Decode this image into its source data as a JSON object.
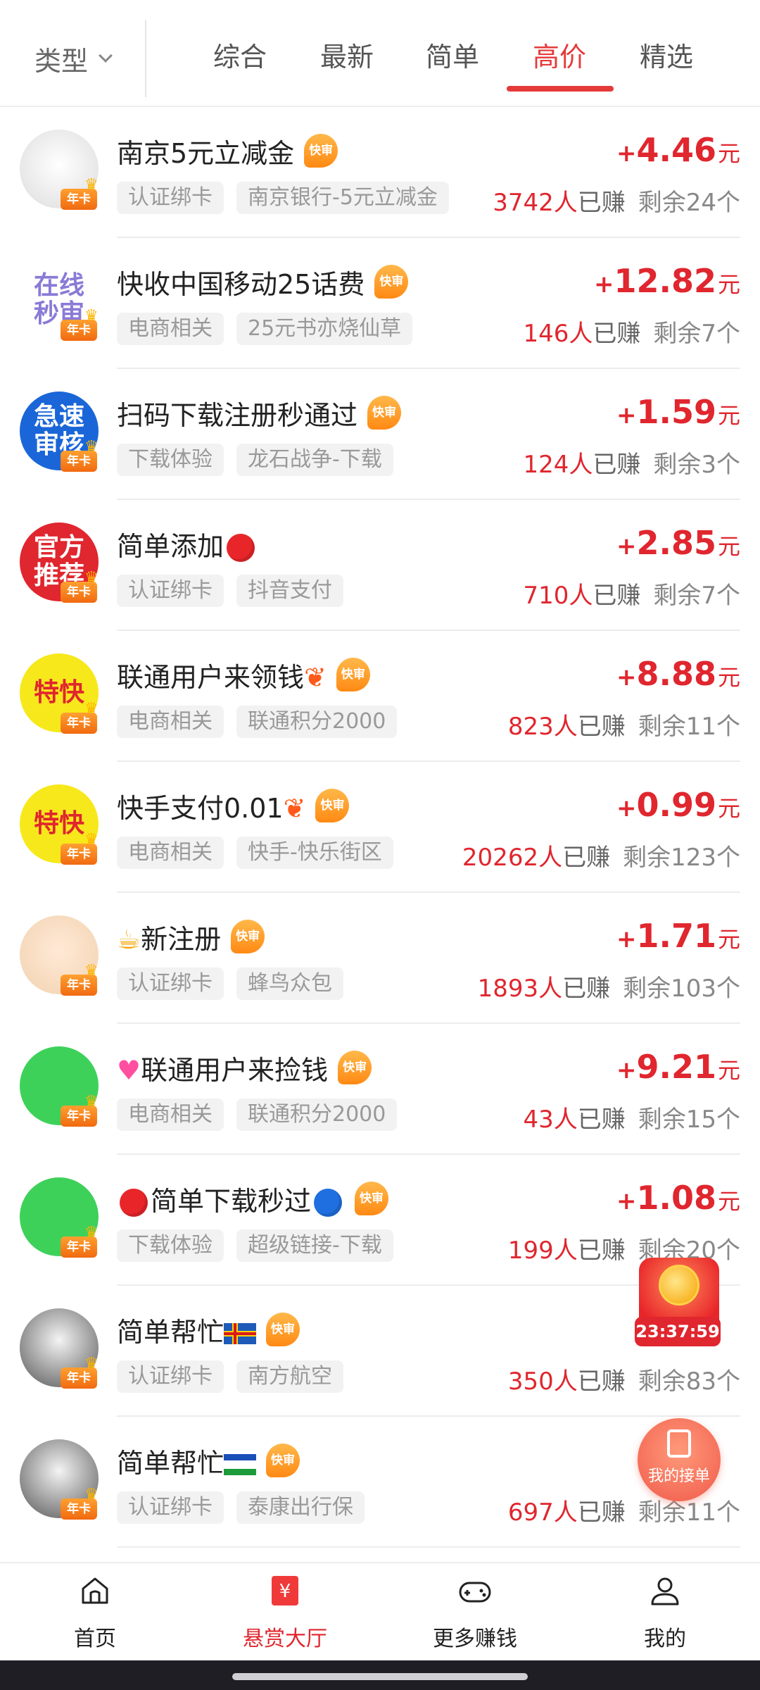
{
  "filter": {
    "type_label": "类型",
    "tabs": [
      "综合",
      "最新",
      "简单",
      "高价",
      "精选"
    ],
    "active_tab": "高价"
  },
  "colors": {
    "accent": "#e0262e",
    "tag_bg": "#f2f2f2",
    "fast_badge": "#ff8a14"
  },
  "badges": {
    "fast": "快审",
    "card": "年卡"
  },
  "labels": {
    "earned_suffix": "已赚",
    "currency": "元",
    "plus": "+"
  },
  "tasks": [
    {
      "title": "南京5元立减金",
      "fast": true,
      "tags": [
        "认证绑卡",
        "南京银行-5元立减金"
      ],
      "price": "4.46",
      "count": "3742人",
      "remain": "剩余24个",
      "avatar_icon": "dog-sunglasses-avatar",
      "avatar_text": ""
    },
    {
      "title": "快收中国移动25话费",
      "fast": true,
      "tags": [
        "电商相关",
        "25元书亦烧仙草"
      ],
      "price": "12.82",
      "count": "146人",
      "remain": "剩余7个",
      "avatar_icon": "online-seconds-avatar",
      "avatar_text": "在线秒审"
    },
    {
      "title": "扫码下载注册秒通过",
      "fast": true,
      "tags": [
        "下载体验",
        "龙石战争-下载"
      ],
      "price": "1.59",
      "count": "124人",
      "remain": "剩余3个",
      "avatar_icon": "fast-review-avatar",
      "avatar_text": "急速审核"
    },
    {
      "title": "简单添加",
      "title_suffix_icon": "red-circle",
      "fast": false,
      "tags": [
        "认证绑卡",
        "抖音支付"
      ],
      "price": "2.85",
      "count": "710人",
      "remain": "剩余7个",
      "avatar_icon": "official-recommend-avatar",
      "avatar_text": "官方推荐"
    },
    {
      "title": "联通用户来领钱",
      "title_suffix_icon": "fire",
      "fast": true,
      "tags": [
        "电商相关",
        "联通积分2000"
      ],
      "price": "8.88",
      "count": "823人",
      "remain": "剩余11个",
      "avatar_icon": "extra-fast-avatar",
      "avatar_text": "特快"
    },
    {
      "title": "快手支付0.01",
      "title_suffix_icon": "fire",
      "fast": true,
      "tags": [
        "电商相关",
        "快手-快乐街区"
      ],
      "price": "0.99",
      "count": "20262人",
      "remain": "剩余123个",
      "avatar_icon": "extra-fast-avatar",
      "avatar_text": "特快"
    },
    {
      "title": "新注册",
      "title_icons": "beer",
      "fast": true,
      "tags": [
        "认证绑卡",
        "蜂鸟众包"
      ],
      "price": "1.71",
      "count": "1893人",
      "remain": "剩余103个",
      "avatar_icon": "cartoon-boy-avatar",
      "avatar_text": ""
    },
    {
      "title": "联通用户来捡钱",
      "title_prefix_icon": "two-hearts",
      "fast": true,
      "tags": [
        "电商相关",
        "联通积分2000"
      ],
      "price": "9.21",
      "count": "43人",
      "remain": "剩余15个",
      "avatar_icon": "frog-avatar",
      "avatar_text": ""
    },
    {
      "title": "简单下载秒过",
      "title_prefix_icon": "red-circle",
      "title_suffix_icon": "blue-circle",
      "fast": true,
      "tags": [
        "下载体验",
        "超级链接-下载"
      ],
      "price": "1.08",
      "count": "199人",
      "remain": "剩余20个",
      "avatar_icon": "frog-avatar",
      "avatar_text": ""
    },
    {
      "title": "简单帮忙",
      "title_suffix_icon": "aland-flag",
      "fast": true,
      "tags": [
        "认证绑卡",
        "南方航空"
      ],
      "price": "",
      "count": "350人",
      "remain": "剩余83个",
      "avatar_icon": "anime-face-avatar",
      "avatar_text": ""
    },
    {
      "title": "简单帮忙",
      "title_suffix_icon": "lesotho-flag",
      "fast": true,
      "tags": [
        "认证绑卡",
        "泰康出行保"
      ],
      "price": "",
      "count": "697人",
      "remain": "剩余11个",
      "avatar_icon": "anime-face-avatar",
      "avatar_text": ""
    }
  ],
  "floating": {
    "timer": "23:37:59",
    "my_orders": "我的接单"
  },
  "bottom_nav": [
    {
      "label": "首页",
      "icon": "home-icon",
      "active": false
    },
    {
      "label": "悬赏大厅",
      "icon": "bounty-hall-icon",
      "active": true
    },
    {
      "label": "更多赚钱",
      "icon": "gamepad-icon",
      "active": false
    },
    {
      "label": "我的",
      "icon": "user-icon",
      "active": false
    }
  ]
}
